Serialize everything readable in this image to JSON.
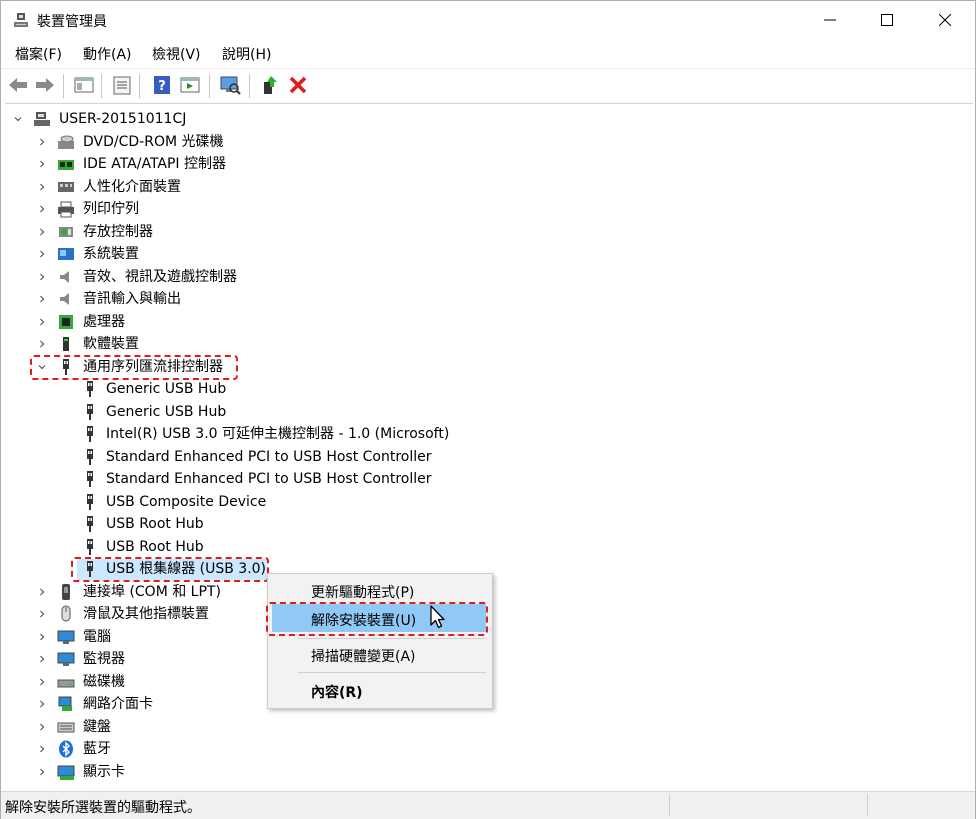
{
  "window": {
    "title": "裝置管理員",
    "minimize_icon": "minimize-icon",
    "maximize_icon": "maximize-icon",
    "close_icon": "close-icon"
  },
  "menu": [
    "檔案(F)",
    "動作(A)",
    "檢視(V)",
    "說明(H)"
  ],
  "toolbar": {
    "icons": [
      "back-arrow-icon",
      "forward-arrow-icon",
      "show-hide-tree-icon",
      "properties-icon",
      "help-icon",
      "run-action-icon",
      "scan-hardware-icon",
      "update-driver-icon",
      "uninstall-x-icon"
    ]
  },
  "tree": {
    "root": "USER-20151011CJ",
    "categories": [
      {
        "label": "DVD/CD-ROM 光碟機",
        "icon": "dvd-drive-icon"
      },
      {
        "label": "IDE ATA/ATAPI 控制器",
        "icon": "ide-controller-icon"
      },
      {
        "label": "人性化介面裝置",
        "icon": "hid-icon"
      },
      {
        "label": "列印佇列",
        "icon": "printer-icon"
      },
      {
        "label": "存放控制器",
        "icon": "storage-controller-icon"
      },
      {
        "label": "系統裝置",
        "icon": "system-device-icon"
      },
      {
        "label": "音效、視訊及遊戲控制器",
        "icon": "speaker-icon"
      },
      {
        "label": "音訊輸入與輸出",
        "icon": "speaker-icon"
      },
      {
        "label": "處理器",
        "icon": "processor-icon"
      },
      {
        "label": "軟體裝置",
        "icon": "software-device-icon"
      }
    ],
    "usb_category": "通用序列匯流排控制器",
    "usb_children": [
      "Generic USB Hub",
      "Generic USB Hub",
      "Intel(R) USB 3.0 可延伸主機控制器 - 1.0 (Microsoft)",
      "Standard Enhanced PCI to USB Host Controller",
      "Standard Enhanced PCI to USB Host Controller",
      "USB Composite Device",
      "USB Root Hub",
      "USB Root Hub",
      "USB 根集線器 (USB 3.0)"
    ],
    "after_categories": [
      {
        "label": "連接埠 (COM 和 LPT)",
        "icon": "port-icon"
      },
      {
        "label": "滑鼠及其他指標裝置",
        "icon": "mouse-icon"
      },
      {
        "label": "電腦",
        "icon": "computer-icon"
      },
      {
        "label": "監視器",
        "icon": "monitor-icon"
      },
      {
        "label": "磁碟機",
        "icon": "disk-drive-icon"
      },
      {
        "label": "網路介面卡",
        "icon": "network-adapter-icon"
      },
      {
        "label": "鍵盤",
        "icon": "keyboard-icon"
      },
      {
        "label": "藍牙",
        "icon": "bluetooth-icon"
      },
      {
        "label": "顯示卡",
        "icon": "display-adapter-icon"
      }
    ]
  },
  "context_menu": {
    "update_driver": "更新驅動程式(P)",
    "uninstall_device": "解除安裝裝置(U)",
    "scan_changes": "掃描硬體變更(A)",
    "properties": "內容(R)"
  },
  "status_bar": {
    "text": "解除安裝所選裝置的驅動程式。"
  },
  "colors": {
    "selection": "#cce8ff",
    "menu_highlight": "#90c8f6",
    "annotation": "#e01c1c"
  }
}
